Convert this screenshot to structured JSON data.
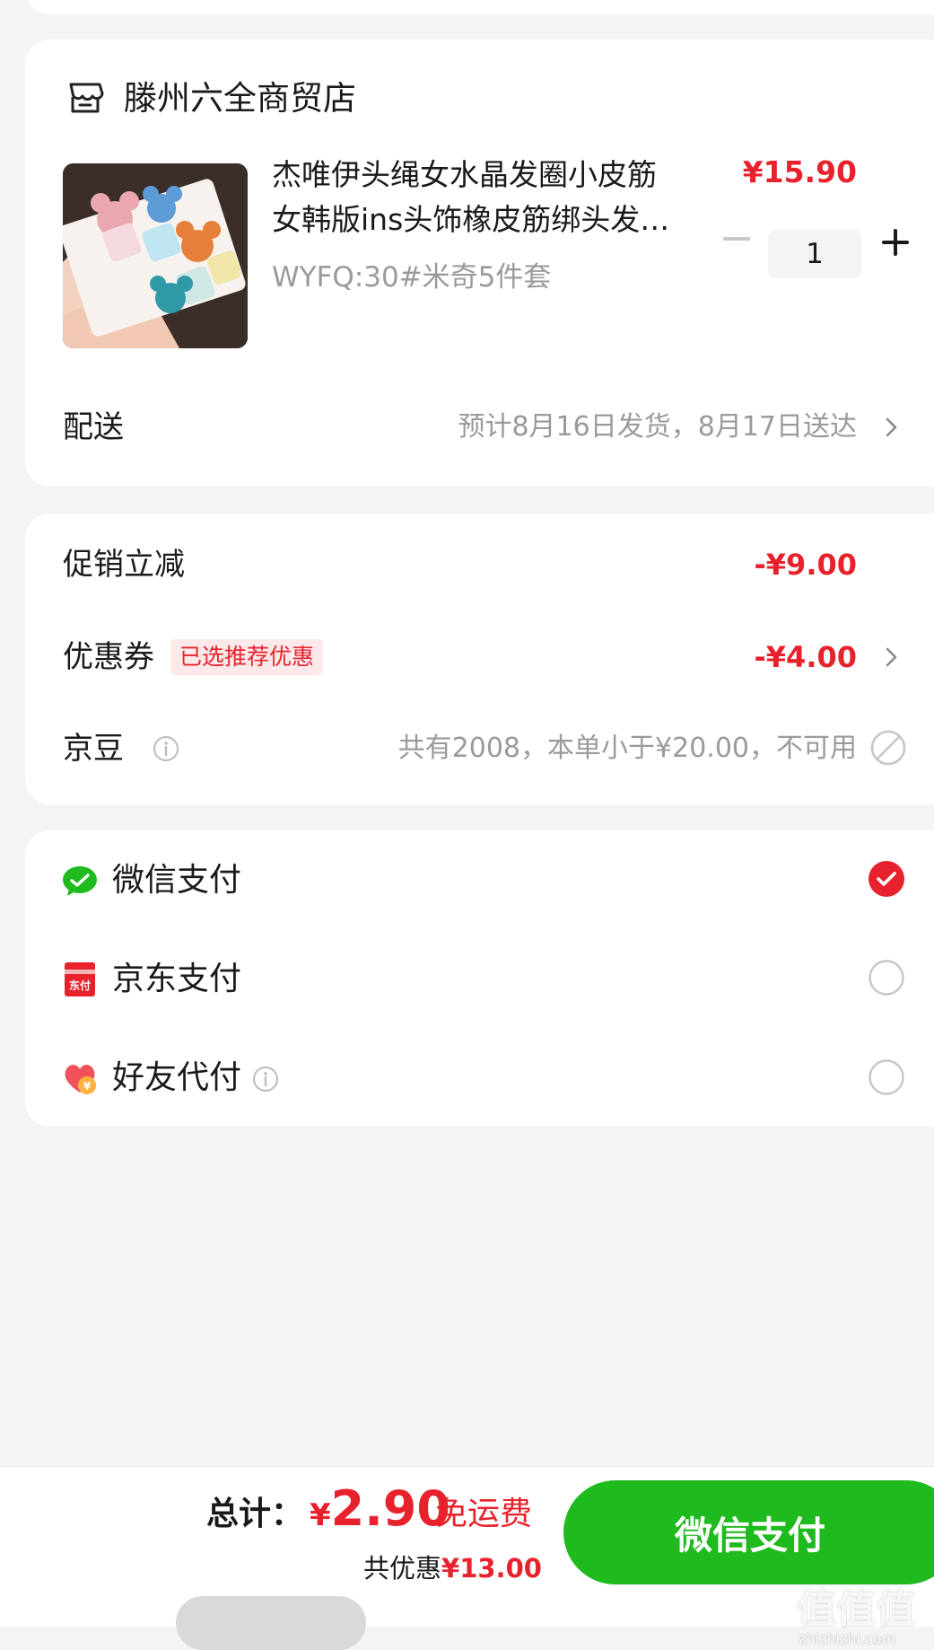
{
  "store": {
    "name": "滕州六全商贸店",
    "icon": "store-icon"
  },
  "product": {
    "title": "杰唯伊头绳女水晶发圈小皮筋女韩版ins头饰橡皮筋绑头发发绳",
    "spec": "WYFQ:30#米奇5件套",
    "price": "¥15.90",
    "quantity": "1"
  },
  "delivery": {
    "label": "配送",
    "value": "预计8月16日发货，8月17日送达"
  },
  "promo": {
    "label": "促销立减",
    "value": "-¥9.00"
  },
  "coupon": {
    "label": "优惠券",
    "badge": "已选推荐优惠",
    "value": "-¥4.00"
  },
  "jingdou": {
    "label": "京豆",
    "value": "共有2008，本单小于¥20.00，不可用"
  },
  "payment_methods": [
    {
      "label": "微信支付",
      "icon": "wechat-pay-icon",
      "selected": true
    },
    {
      "label": "京东支付",
      "icon": "jd-pay-icon",
      "selected": false
    },
    {
      "label": "好友代付",
      "icon": "friend-pay-icon",
      "selected": false
    }
  ],
  "bottom": {
    "total_label": "总计：",
    "currency": "¥",
    "total_amount": "2.90",
    "free_shipping": "免运费",
    "discount_prefix": "共优惠",
    "discount_amount": "¥13.00",
    "pay_button": "微信支付"
  },
  "watermark": {
    "main": "值值值",
    "sub": "zhizhizhi.com"
  },
  "colors": {
    "accent_red": "#e8222d",
    "wechat_green": "#1fba1e",
    "background": "#f4f4f4"
  }
}
